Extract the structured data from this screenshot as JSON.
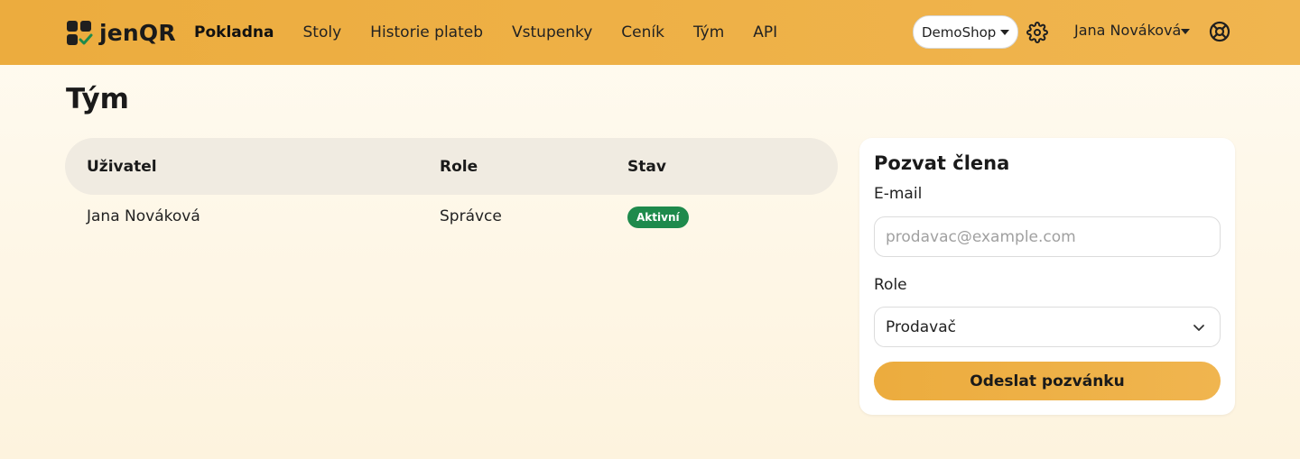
{
  "brand": {
    "name": "jenQR",
    "icon": "qr-logo-icon"
  },
  "nav": {
    "links": [
      "Pokladna",
      "Stoly",
      "Historie plateb",
      "Vstupenky",
      "Ceník",
      "Tým",
      "API"
    ],
    "active": "Pokladna"
  },
  "header": {
    "shop_selector": "DemoShop",
    "settings_icon": "gear-icon",
    "user_name": "Jana Nováková",
    "help_icon": "lifebuoy-icon"
  },
  "page": {
    "title": "Tým"
  },
  "table": {
    "columns": [
      "Uživatel",
      "Role",
      "Stav"
    ],
    "rows": [
      {
        "user": "Jana Nováková",
        "role": "Správce",
        "status": "Aktivní"
      }
    ]
  },
  "invite": {
    "title": "Pozvat člena",
    "email_label": "E-mail",
    "email_placeholder": "prodavac@example.com",
    "email_value": "",
    "role_label": "Role",
    "role_value": "Prodavač",
    "submit_label": "Odeslat pozvánku"
  },
  "colors": {
    "accent": "#ecac3e",
    "status_active": "#1e8a4c",
    "logo_check": "#1e8a4c"
  }
}
